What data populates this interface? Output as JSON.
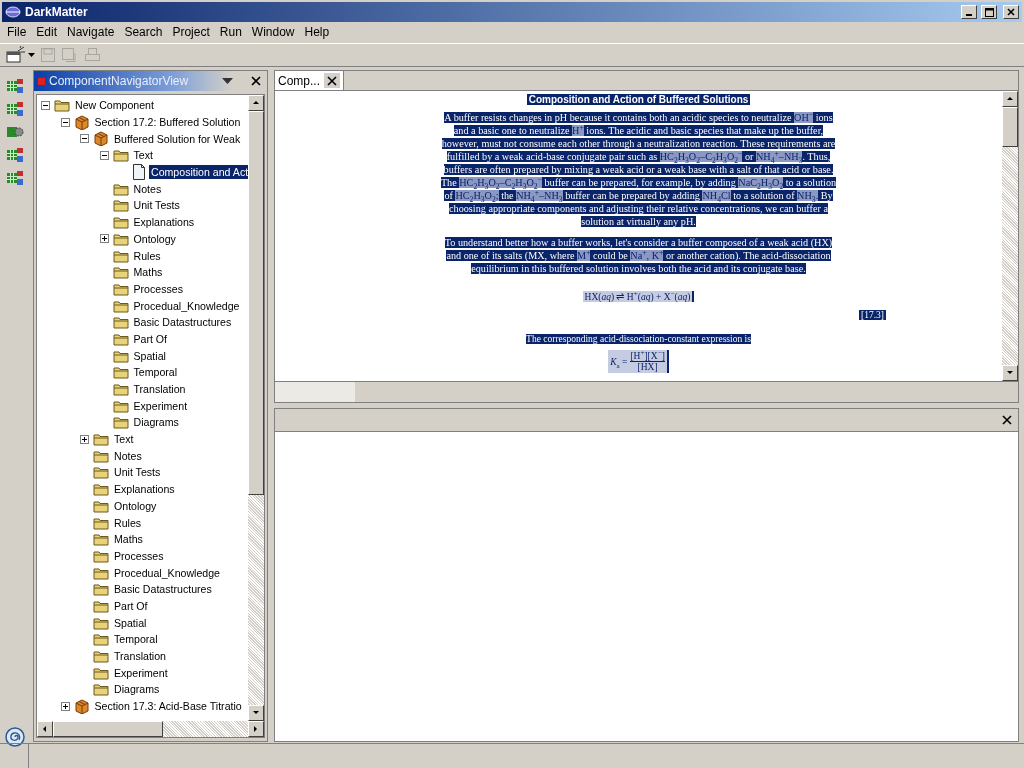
{
  "window": {
    "title": "DarkMatter"
  },
  "menu": [
    "File",
    "Edit",
    "Navigate",
    "Search",
    "Project",
    "Run",
    "Window",
    "Help"
  ],
  "toolbar": [
    {
      "kind": "new",
      "disabled": false
    },
    {
      "kind": "save",
      "disabled": true
    },
    {
      "kind": "save_all",
      "disabled": true
    },
    {
      "kind": "print",
      "disabled": true
    }
  ],
  "side_tools": [
    {
      "kind": "grid"
    },
    {
      "kind": "grid"
    },
    {
      "kind": "gear"
    },
    {
      "kind": "grid"
    },
    {
      "kind": "grid"
    }
  ],
  "navigator": {
    "title": "ComponentNavigatorView",
    "tree": [
      {
        "label": "New Component",
        "kind": "folder",
        "expanded": true,
        "selected": false,
        "children": [
          {
            "label": "Section 17.2: Buffered Solution",
            "kind": "package",
            "expanded": true,
            "selected": false,
            "children": [
              {
                "label": "Buffered Solution for Weak",
                "kind": "package",
                "expanded": true,
                "selected": false,
                "children": [
                  {
                    "label": "Text",
                    "kind": "folder",
                    "expanded": true,
                    "selected": false,
                    "children": [
                      {
                        "label": "Composition and Act",
                        "kind": "document",
                        "selected": true
                      }
                    ]
                  },
                  {
                    "label": "Notes",
                    "kind": "folder",
                    "selected": false
                  },
                  {
                    "label": "Unit Tests",
                    "kind": "folder",
                    "selected": false
                  },
                  {
                    "label": "Explanations",
                    "kind": "folder",
                    "selected": false
                  },
                  {
                    "label": "Ontology",
                    "kind": "folder",
                    "expanded": false,
                    "selected": false
                  },
                  {
                    "label": "Rules",
                    "kind": "folder",
                    "selected": false
                  },
                  {
                    "label": "Maths",
                    "kind": "folder",
                    "selected": false
                  },
                  {
                    "label": "Processes",
                    "kind": "folder",
                    "selected": false
                  },
                  {
                    "label": "Procedual_Knowledge",
                    "kind": "folder",
                    "selected": false
                  },
                  {
                    "label": "Basic Datastructures",
                    "kind": "folder",
                    "selected": false
                  },
                  {
                    "label": "Part Of",
                    "kind": "folder",
                    "selected": false
                  },
                  {
                    "label": "Spatial",
                    "kind": "folder",
                    "selected": false
                  },
                  {
                    "label": "Temporal",
                    "kind": "folder",
                    "selected": false
                  },
                  {
                    "label": "Translation",
                    "kind": "folder",
                    "selected": false
                  },
                  {
                    "label": "Experiment",
                    "kind": "folder",
                    "selected": false
                  },
                  {
                    "label": "Diagrams",
                    "kind": "folder",
                    "selected": false
                  }
                ]
              },
              {
                "label": "Text",
                "kind": "folder",
                "expanded": false,
                "selected": false
              },
              {
                "label": "Notes",
                "kind": "folder",
                "selected": false
              },
              {
                "label": "Unit Tests",
                "kind": "folder",
                "selected": false
              },
              {
                "label": "Explanations",
                "kind": "folder",
                "selected": false
              },
              {
                "label": "Ontology",
                "kind": "folder",
                "selected": false
              },
              {
                "label": "Rules",
                "kind": "folder",
                "selected": false
              },
              {
                "label": "Maths",
                "kind": "folder",
                "selected": false
              },
              {
                "label": "Processes",
                "kind": "folder",
                "selected": false
              },
              {
                "label": "Procedual_Knowledge",
                "kind": "folder",
                "selected": false
              },
              {
                "label": "Basic Datastructures",
                "kind": "folder",
                "selected": false
              },
              {
                "label": "Part Of",
                "kind": "folder",
                "selected": false
              },
              {
                "label": "Spatial",
                "kind": "folder",
                "selected": false
              },
              {
                "label": "Temporal",
                "kind": "folder",
                "selected": false
              },
              {
                "label": "Translation",
                "kind": "folder",
                "selected": false
              },
              {
                "label": "Experiment",
                "kind": "folder",
                "selected": false
              },
              {
                "label": "Diagrams",
                "kind": "folder",
                "selected": false
              }
            ]
          },
          {
            "label": "Section 17.3: Acid-Base Titratio",
            "kind": "package",
            "expanded": false,
            "selected": false
          }
        ]
      }
    ]
  },
  "editor": {
    "tabs": [
      {
        "label": "Comp...",
        "selected": true
      }
    ],
    "document": [
      {
        "kind": "heading",
        "text": "Composition and Action of Buffered Solutions"
      },
      {
        "kind": "paragraph",
        "segments": [
          {
            "kind": "text",
            "text": "A buffer resists changes in pH because it contains both an acidic species to neutralize "
          },
          {
            "kind": "formula",
            "text": "OH$^{−}$"
          },
          {
            "kind": "text",
            "text": " ions and a basic one to neutralize "
          },
          {
            "kind": "formula",
            "text": "H$^{+}$"
          },
          {
            "kind": "text",
            "text": " ions. The acidic and basic species that make up the buffer, however, must not consume each other through a neutralization reaction. These requirements are fulfilled by a weak acid-base conjugate pair such as "
          },
          {
            "kind": "formula",
            "text": "HC$_{2}$H$_{3}$O$_{2}$–C$_{2}$H$_{3}$O$_{2}$$^{−}$"
          },
          {
            "kind": "text",
            "text": " or "
          },
          {
            "kind": "formula",
            "text": "NH$_{4}$$^{+}$–NH$_{3}$"
          },
          {
            "kind": "text",
            "text": ". Thus, buffers are often prepared by mixing a weak acid or a weak base with a salt of that acid or base. The "
          },
          {
            "kind": "formula",
            "text": "HC$_{2}$H$_{3}$O$_{2}$–C$_{2}$H$_{3}$O$_{2}$$^{−}$"
          },
          {
            "kind": "text",
            "text": " buffer can be prepared, for example, by adding "
          },
          {
            "kind": "formula",
            "text": "NaC$_{2}$H$_{3}$O$_{2}$"
          },
          {
            "kind": "text",
            "text": " to a solution of "
          },
          {
            "kind": "formula",
            "text": "HC$_{2}$H$_{3}$O$_{2}$;"
          },
          {
            "kind": "text",
            "text": " the "
          },
          {
            "kind": "formula",
            "text": "NH$_{4}$$^{+}$–NH$_{3}$"
          },
          {
            "kind": "text",
            "text": " buffer can be prepared by adding "
          },
          {
            "kind": "formula",
            "text": "NH$_{4}$Cl"
          },
          {
            "kind": "text",
            "text": " to a solution of "
          },
          {
            "kind": "formula",
            "text": "NH$_{3}$."
          },
          {
            "kind": "text",
            "text": " By choosing appropriate components and adjusting their relative concentrations, we can buffer a solution at virtually any pH."
          }
        ]
      },
      {
        "kind": "paragraph",
        "segments": [
          {
            "kind": "text",
            "text": "To understand better how a buffer works, let's consider a buffer composed of a weak acid (HX) and one of its salts (MX, where "
          },
          {
            "kind": "formula",
            "text": "M$^{+}$"
          },
          {
            "kind": "text",
            "text": " could be "
          },
          {
            "kind": "formula",
            "text": "Na$^{+}$, K$^{+}$"
          },
          {
            "kind": "text",
            "text": " or another cation). The acid-dissociation equilibrium in this buffered solution involves both the acid and its conjugate base."
          }
        ]
      },
      {
        "kind": "equation",
        "text": "HX(*aq*) ⇌ H$^{+}$(*aq*) + X$^{−}$(*aq*)"
      },
      {
        "kind": "number",
        "text": "[17.3]"
      },
      {
        "kind": "sentence",
        "text": "The corresponding acid-dissociation-constant expression is"
      },
      {
        "kind": "fraction",
        "lhs": "*K*$_{a}$ =",
        "numerator": "[H$^{+}$][X$^{−}$]",
        "denominator": "[HX]"
      }
    ]
  }
}
